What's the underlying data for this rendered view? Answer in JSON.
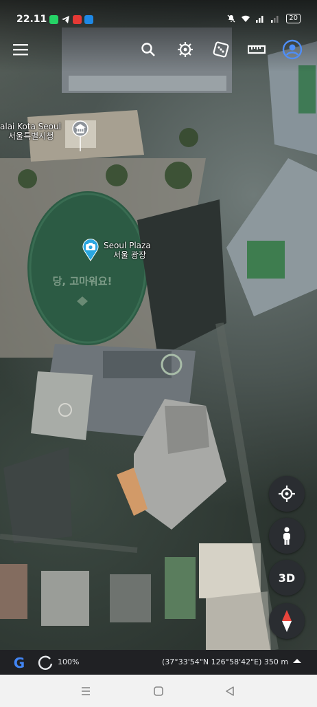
{
  "status_bar": {
    "time": "22.11",
    "battery": "20",
    "notification_icons": [
      "whatsapp-icon",
      "telegram-icon",
      "youtube-icon",
      "messages-icon"
    ],
    "right_icons": [
      "mute-icon",
      "wifi-icon",
      "signal-icon",
      "signal-icon"
    ]
  },
  "toolbar": {
    "icons": [
      "menu-icon",
      "search-icon",
      "voyager-icon",
      "feeling-lucky-icon",
      "measure-icon",
      "account-icon"
    ]
  },
  "places": {
    "city_hall": {
      "name": "alai Kota Seoul",
      "native": "서울특별시청"
    },
    "plaza": {
      "name": "Seoul Plaza",
      "native": "서울 광장"
    }
  },
  "map_text": {
    "lawn_text": "당, 고마워요!"
  },
  "controls": {
    "locate": "my-location-icon",
    "street_view": "pegman-icon",
    "toggle_3d": "3D",
    "compass": "compass-icon"
  },
  "info_bar": {
    "logo": "G",
    "progress": "100%",
    "coordinates": "(37°33'54\"N 126°58'42\"E) 350 m"
  },
  "nav_bar": {
    "icons": [
      "recent-apps-icon",
      "home-icon",
      "back-icon"
    ]
  },
  "colors": {
    "accent": "#4f8ef7",
    "pin_blue": "#2aa7e0",
    "lawn": "#2c5b44",
    "info_bar_bg": "#202124",
    "fab_bg": "#2a2d31"
  }
}
